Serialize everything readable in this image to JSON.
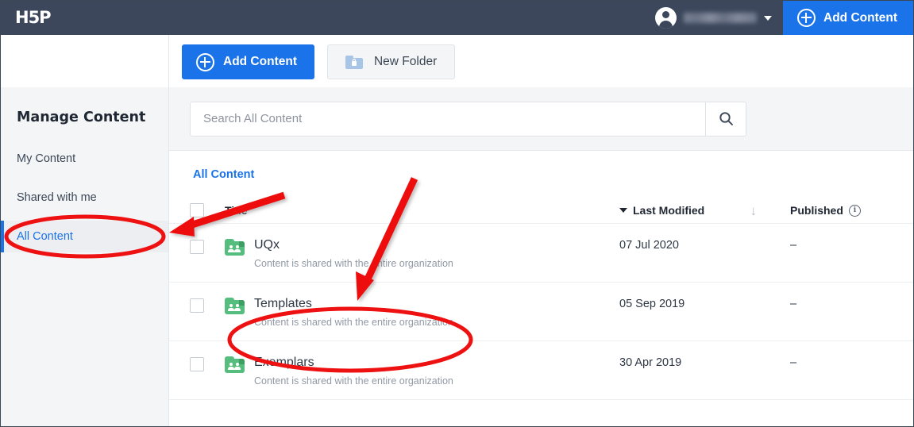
{
  "topbar": {
    "logo": "H5P",
    "user_name": "",
    "avatar_icon": "user-avatar-icon",
    "caret_icon": "chevron-down-icon",
    "add_content_label": "Add Content",
    "add_content_icon": "plus-circle-icon"
  },
  "toolbar": {
    "add_content_label": "Add Content",
    "add_content_icon": "plus-circle-icon",
    "new_folder_label": "New Folder",
    "new_folder_icon": "folder-lock-icon"
  },
  "sidebar": {
    "title": "Manage Content",
    "items": [
      {
        "label": "My Content",
        "active": false
      },
      {
        "label": "Shared with me",
        "active": false
      },
      {
        "label": "All Content",
        "active": true
      }
    ]
  },
  "search": {
    "placeholder": "Search All Content",
    "value": "",
    "button_icon": "search-icon"
  },
  "main": {
    "breadcrumb": "All Content",
    "columns": {
      "title": "Title",
      "last_modified": "Last Modified",
      "published": "Published",
      "published_info_glyph": "i",
      "sort_indicator": "↓"
    },
    "rows": [
      {
        "title": "UQx",
        "subtitle": "Content is shared with the entire organization",
        "last_modified": "07 Jul 2020",
        "published": "–",
        "icon": "shared-folder-icon",
        "checked": false
      },
      {
        "title": "Templates",
        "subtitle": "Content is shared with the entire organization",
        "last_modified": "05 Sep 2019",
        "published": "–",
        "icon": "shared-folder-icon",
        "checked": false
      },
      {
        "title": "Exemplars",
        "subtitle": "Content is shared with the entire organization",
        "last_modified": "30 Apr 2019",
        "published": "–",
        "icon": "shared-folder-icon",
        "checked": false
      }
    ]
  },
  "colors": {
    "topbar": "#3c475c",
    "accent_blue": "#1a73e8",
    "sidebar_bg": "#f4f5f7",
    "folder_green": "#55bd7e",
    "annotation_red": "#ee1111"
  },
  "annotations": {
    "arrow_to_all_content": "red-arrow",
    "arrow_to_templates": "red-arrow",
    "ellipse_all_content": "red-ellipse",
    "ellipse_templates_row": "red-ellipse"
  }
}
